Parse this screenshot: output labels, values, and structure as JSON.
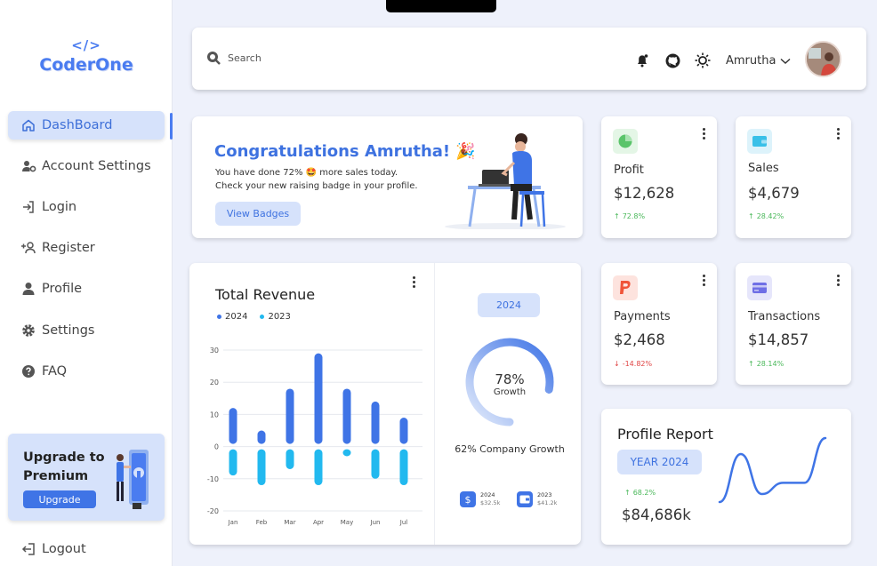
{
  "brand": {
    "mark": "</>",
    "name": "CoderOne",
    "accent": "#4a7cf0"
  },
  "sidebar": {
    "items": [
      {
        "label": "DashBoard",
        "icon": "home-icon",
        "active": true
      },
      {
        "label": "Account Settings",
        "icon": "user-gear-icon",
        "active": false
      },
      {
        "label": "Login",
        "icon": "login-icon",
        "active": false
      },
      {
        "label": "Register",
        "icon": "user-plus-icon",
        "active": false
      },
      {
        "label": "Profile",
        "icon": "user-icon",
        "active": false
      },
      {
        "label": "Settings",
        "icon": "gear-icon",
        "active": false
      },
      {
        "label": "FAQ",
        "icon": "question-icon",
        "active": false
      }
    ],
    "upgrade": {
      "title": "Upgrade to Premium",
      "button": "Upgrade"
    },
    "logout": "Logout"
  },
  "topbar": {
    "search_placeholder": "Search",
    "icons": [
      "bell-icon",
      "github-icon",
      "sun-icon"
    ],
    "user_name": "Amrutha"
  },
  "congrats": {
    "title": "Congratulations Amrutha! 🎉",
    "line1": "You have done 72% 🤩 more sales today.",
    "line2": "Check your new raising badge in your profile.",
    "button": "View Badges"
  },
  "stats": {
    "profit": {
      "label": "Profit",
      "value": "$12,628",
      "delta": "72.8%",
      "trend": "up",
      "icon": "pie-chart-icon",
      "color": "#5ac46a"
    },
    "sales": {
      "label": "Sales",
      "value": "$4,679",
      "delta": "28.42%",
      "trend": "up",
      "icon": "wallet-icon",
      "color": "#39c0e8"
    },
    "payments": {
      "label": "Payments",
      "value": "$2,468",
      "delta": "-14.82%",
      "trend": "down",
      "icon": "paypal-icon",
      "color": "#f0553a"
    },
    "transactions": {
      "label": "Transactions",
      "value": "$14,857",
      "delta": "28.14%",
      "trend": "up",
      "icon": "card-icon",
      "color": "#6f6fe6"
    }
  },
  "revenue": {
    "title": "Total Revenue",
    "growth_year": "2024",
    "growth_pct": "78%",
    "growth_label": "Growth",
    "company_growth": "62% Company Growth",
    "growth_fraction": 0.78,
    "mini": [
      {
        "year": "2024",
        "value": "$32.5k",
        "icon": "dollar-icon"
      },
      {
        "year": "2023",
        "value": "$41.2k",
        "icon": "wallet-icon"
      }
    ]
  },
  "chart_data": {
    "type": "bar",
    "categories": [
      "Jan",
      "Feb",
      "Mar",
      "Apr",
      "May",
      "Jun",
      "Jul"
    ],
    "series": [
      {
        "name": "2024",
        "color": "#3f74e6",
        "values": [
          12,
          5,
          18,
          29,
          18,
          14,
          9
        ]
      },
      {
        "name": "2023",
        "color": "#22b9ef",
        "values": [
          -9,
          -12,
          -7,
          -12,
          -3,
          -10,
          -12
        ]
      }
    ],
    "y_ticks": [
      30,
      20,
      10,
      0,
      -10,
      -20
    ],
    "ylim": [
      -20,
      30
    ],
    "grid": true,
    "legend": "top-left"
  },
  "report": {
    "title": "Profile Report",
    "year": "YEAR 2024",
    "delta": "68.2%",
    "value": "$84,686k",
    "line_values": [
      0,
      30,
      5,
      12,
      12,
      40
    ],
    "line_color": "#3f74e6"
  }
}
